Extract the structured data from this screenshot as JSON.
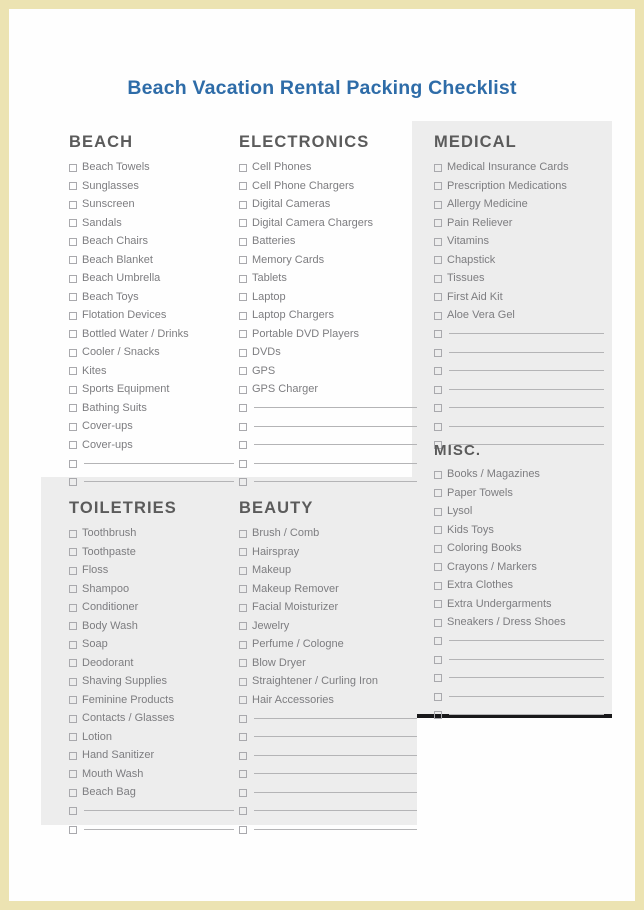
{
  "document": {
    "title": "Beach Vacation Rental Packing Checklist"
  },
  "colors": {
    "title": "#2e6ca8",
    "page_border": "#ece3b2",
    "panel_background": "#ededed",
    "heading_text": "#5b5b5b",
    "item_text": "#7d7d80",
    "accent_bar": "#18181a"
  },
  "sections": [
    {
      "id": "beach",
      "heading": "BEACH",
      "items": [
        "Beach Towels",
        "Sunglasses",
        "Sunscreen",
        "Sandals",
        "Beach Chairs",
        "Beach Blanket",
        "Beach Umbrella",
        "Beach Toys",
        "Flotation Devices",
        "Bottled Water / Drinks",
        "Cooler / Snacks",
        "Kites",
        "Sports Equipment",
        "Bathing Suits",
        "Cover-ups",
        "Cover-ups"
      ],
      "blank_lines": 2
    },
    {
      "id": "electronics",
      "heading": "ELECTRONICS",
      "items": [
        "Cell Phones",
        "Cell Phone Chargers",
        "Digital Cameras",
        "Digital Camera Chargers",
        "Batteries",
        "Memory Cards",
        "Tablets",
        "Laptop",
        "Laptop Chargers",
        "Portable DVD Players",
        "DVDs",
        "GPS",
        "GPS Charger"
      ],
      "blank_lines": 5
    },
    {
      "id": "medical",
      "heading": "MEDICAL",
      "items": [
        "Medical Insurance Cards",
        "Prescription Medications",
        "Allergy Medicine",
        "Pain Reliever",
        "Vitamins",
        "Chapstick",
        "Tissues",
        "First Aid Kit",
        "Aloe Vera Gel"
      ],
      "blank_lines": 7
    },
    {
      "id": "misc",
      "heading": "MISC.",
      "items": [
        "Books / Magazines",
        "Paper Towels",
        "Lysol",
        "Kids Toys",
        "Coloring Books",
        "Crayons / Markers",
        "Extra Clothes",
        "Extra Undergarments",
        "Sneakers / Dress Shoes"
      ],
      "blank_lines": 5
    },
    {
      "id": "toiletries",
      "heading": "TOILETRIES",
      "items": [
        "Toothbrush",
        "Toothpaste",
        "Floss",
        "Shampoo",
        "Conditioner",
        "Body Wash",
        "Soap",
        "Deodorant",
        "Shaving Supplies",
        "Feminine Products",
        "Contacts / Glasses",
        "Lotion",
        "Hand Sanitizer",
        "Mouth Wash",
        "Beach Bag"
      ],
      "blank_lines": 2
    },
    {
      "id": "beauty",
      "heading": "BEAUTY",
      "items": [
        "Brush / Comb",
        "Hairspray",
        "Makeup",
        "Makeup Remover",
        "Facial Moisturizer",
        "Jewelry",
        "Perfume / Cologne",
        "Blow Dryer",
        "Straightener / Curling Iron",
        "Hair Accessories"
      ],
      "blank_lines": 7
    }
  ]
}
